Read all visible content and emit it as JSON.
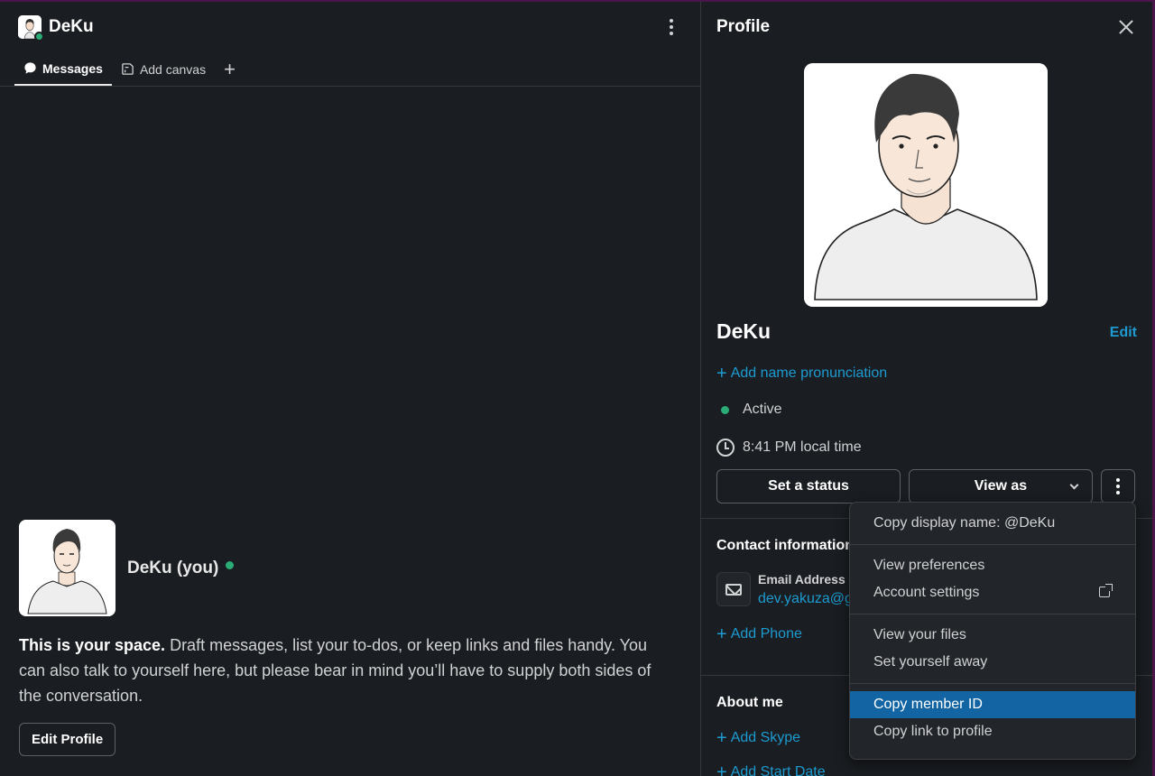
{
  "channel": {
    "title": "DeKu",
    "tabs": [
      {
        "label": "Messages"
      },
      {
        "label": "Add canvas"
      }
    ],
    "intro": {
      "name": "DeKu (you)",
      "lead": "This is your space.",
      "body": " Draft messages, list your to-dos, or keep links and files handy. You can also talk to yourself here, but please bear in mind you’ll have to supply both sides of the conversation.",
      "edit_profile_label": "Edit Profile"
    }
  },
  "profile": {
    "title": "Profile",
    "name": "DeKu",
    "edit_label": "Edit",
    "add_pronunciation": "Add name pronunciation",
    "status": "Active",
    "local_time": "8:41 PM local time",
    "set_status_label": "Set a status",
    "view_as_label": "View as",
    "contact_title": "Contact information",
    "email_label": "Email Address",
    "email_value": "dev.yakuza@gmail.com",
    "add_phone": "Add Phone",
    "about_title": "About me",
    "add_skype": "Add Skype",
    "add_start_date": "Add Start Date"
  },
  "menu": {
    "items": [
      {
        "label": "Copy display name: @DeKu"
      },
      {
        "label": "View preferences"
      },
      {
        "label": "Account settings"
      },
      {
        "label": "View your files"
      },
      {
        "label": "Set yourself away"
      },
      {
        "label": "Copy member ID"
      },
      {
        "label": "Copy link to profile"
      }
    ]
  },
  "colors": {
    "background": "#1a1d21",
    "link": "#1d9bd1",
    "presence": "#2bac76",
    "menu_highlight": "#1264a3"
  }
}
